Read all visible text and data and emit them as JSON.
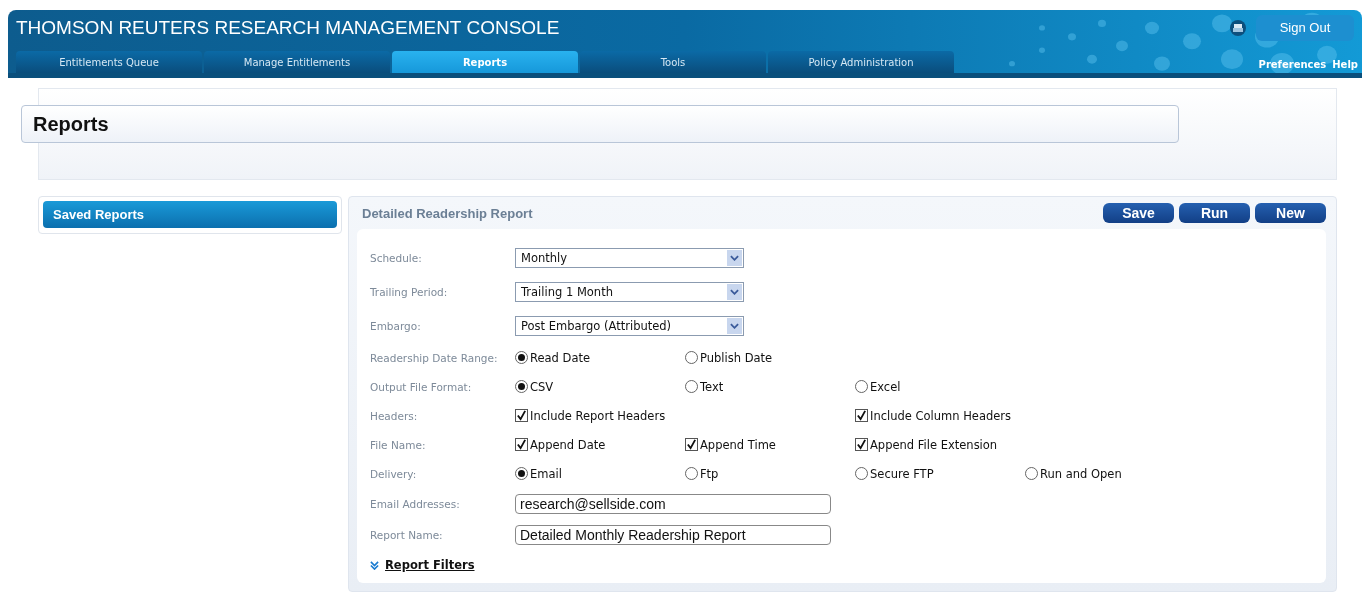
{
  "app": {
    "title": "THOMSON REUTERS RESEARCH MANAGEMENT CONSOLE",
    "sign_out": "Sign Out",
    "links": [
      "Preferences",
      "Help"
    ]
  },
  "tabs": [
    {
      "label": "Entitlements Queue",
      "selected": false
    },
    {
      "label": "Manage Entitlements",
      "selected": false
    },
    {
      "label": "Reports",
      "selected": true
    },
    {
      "label": "Tools",
      "selected": false
    },
    {
      "label": "Policy Administration",
      "selected": false
    }
  ],
  "page_title": "Reports",
  "sidebar": {
    "items": [
      {
        "label": "Saved Reports",
        "selected": true
      }
    ]
  },
  "report": {
    "title": "Detailed Readership Report",
    "buttons": [
      "Save",
      "Run",
      "New"
    ],
    "rows": [
      {
        "kind": "select",
        "label": "Schedule:",
        "value": "Monthly"
      },
      {
        "kind": "select",
        "label": "Trailing Period:",
        "value": "Trailing 1 Month"
      },
      {
        "kind": "select",
        "label": "Embargo:",
        "value": "Post Embargo (Attributed)"
      },
      {
        "kind": "radio",
        "label": "Readership Date Range:",
        "options": [
          {
            "label": "Read Date",
            "selected": true
          },
          {
            "label": "Publish Date",
            "selected": false
          }
        ]
      },
      {
        "kind": "radio",
        "label": "Output File Format:",
        "options": [
          {
            "label": "CSV",
            "selected": true
          },
          {
            "label": "Text",
            "selected": false
          },
          {
            "label": "Excel",
            "selected": false
          }
        ]
      },
      {
        "kind": "check",
        "label": "Headers:",
        "options": [
          {
            "label": "Include Report Headers",
            "checked": true
          },
          {
            "label": "Include Column Headers",
            "checked": true
          }
        ]
      },
      {
        "kind": "check",
        "label": "File Name:",
        "options": [
          {
            "label": "Append Date",
            "checked": true
          },
          {
            "label": "Append Time",
            "checked": true
          },
          {
            "label": "Append File Extension",
            "checked": true
          }
        ]
      },
      {
        "kind": "radio",
        "label": "Delivery:",
        "options": [
          {
            "label": "Email",
            "selected": true
          },
          {
            "label": "Ftp",
            "selected": false
          },
          {
            "label": "Secure FTP",
            "selected": false
          },
          {
            "label": "Run and Open",
            "selected": false
          }
        ]
      },
      {
        "kind": "text",
        "label": "Email Addresses:",
        "value": "research@sellside.com"
      },
      {
        "kind": "text",
        "label": "Report Name:",
        "value": "Detailed Monthly Readership Report"
      }
    ],
    "filters_link": "Report Filters",
    "filters_expanded": false
  }
}
